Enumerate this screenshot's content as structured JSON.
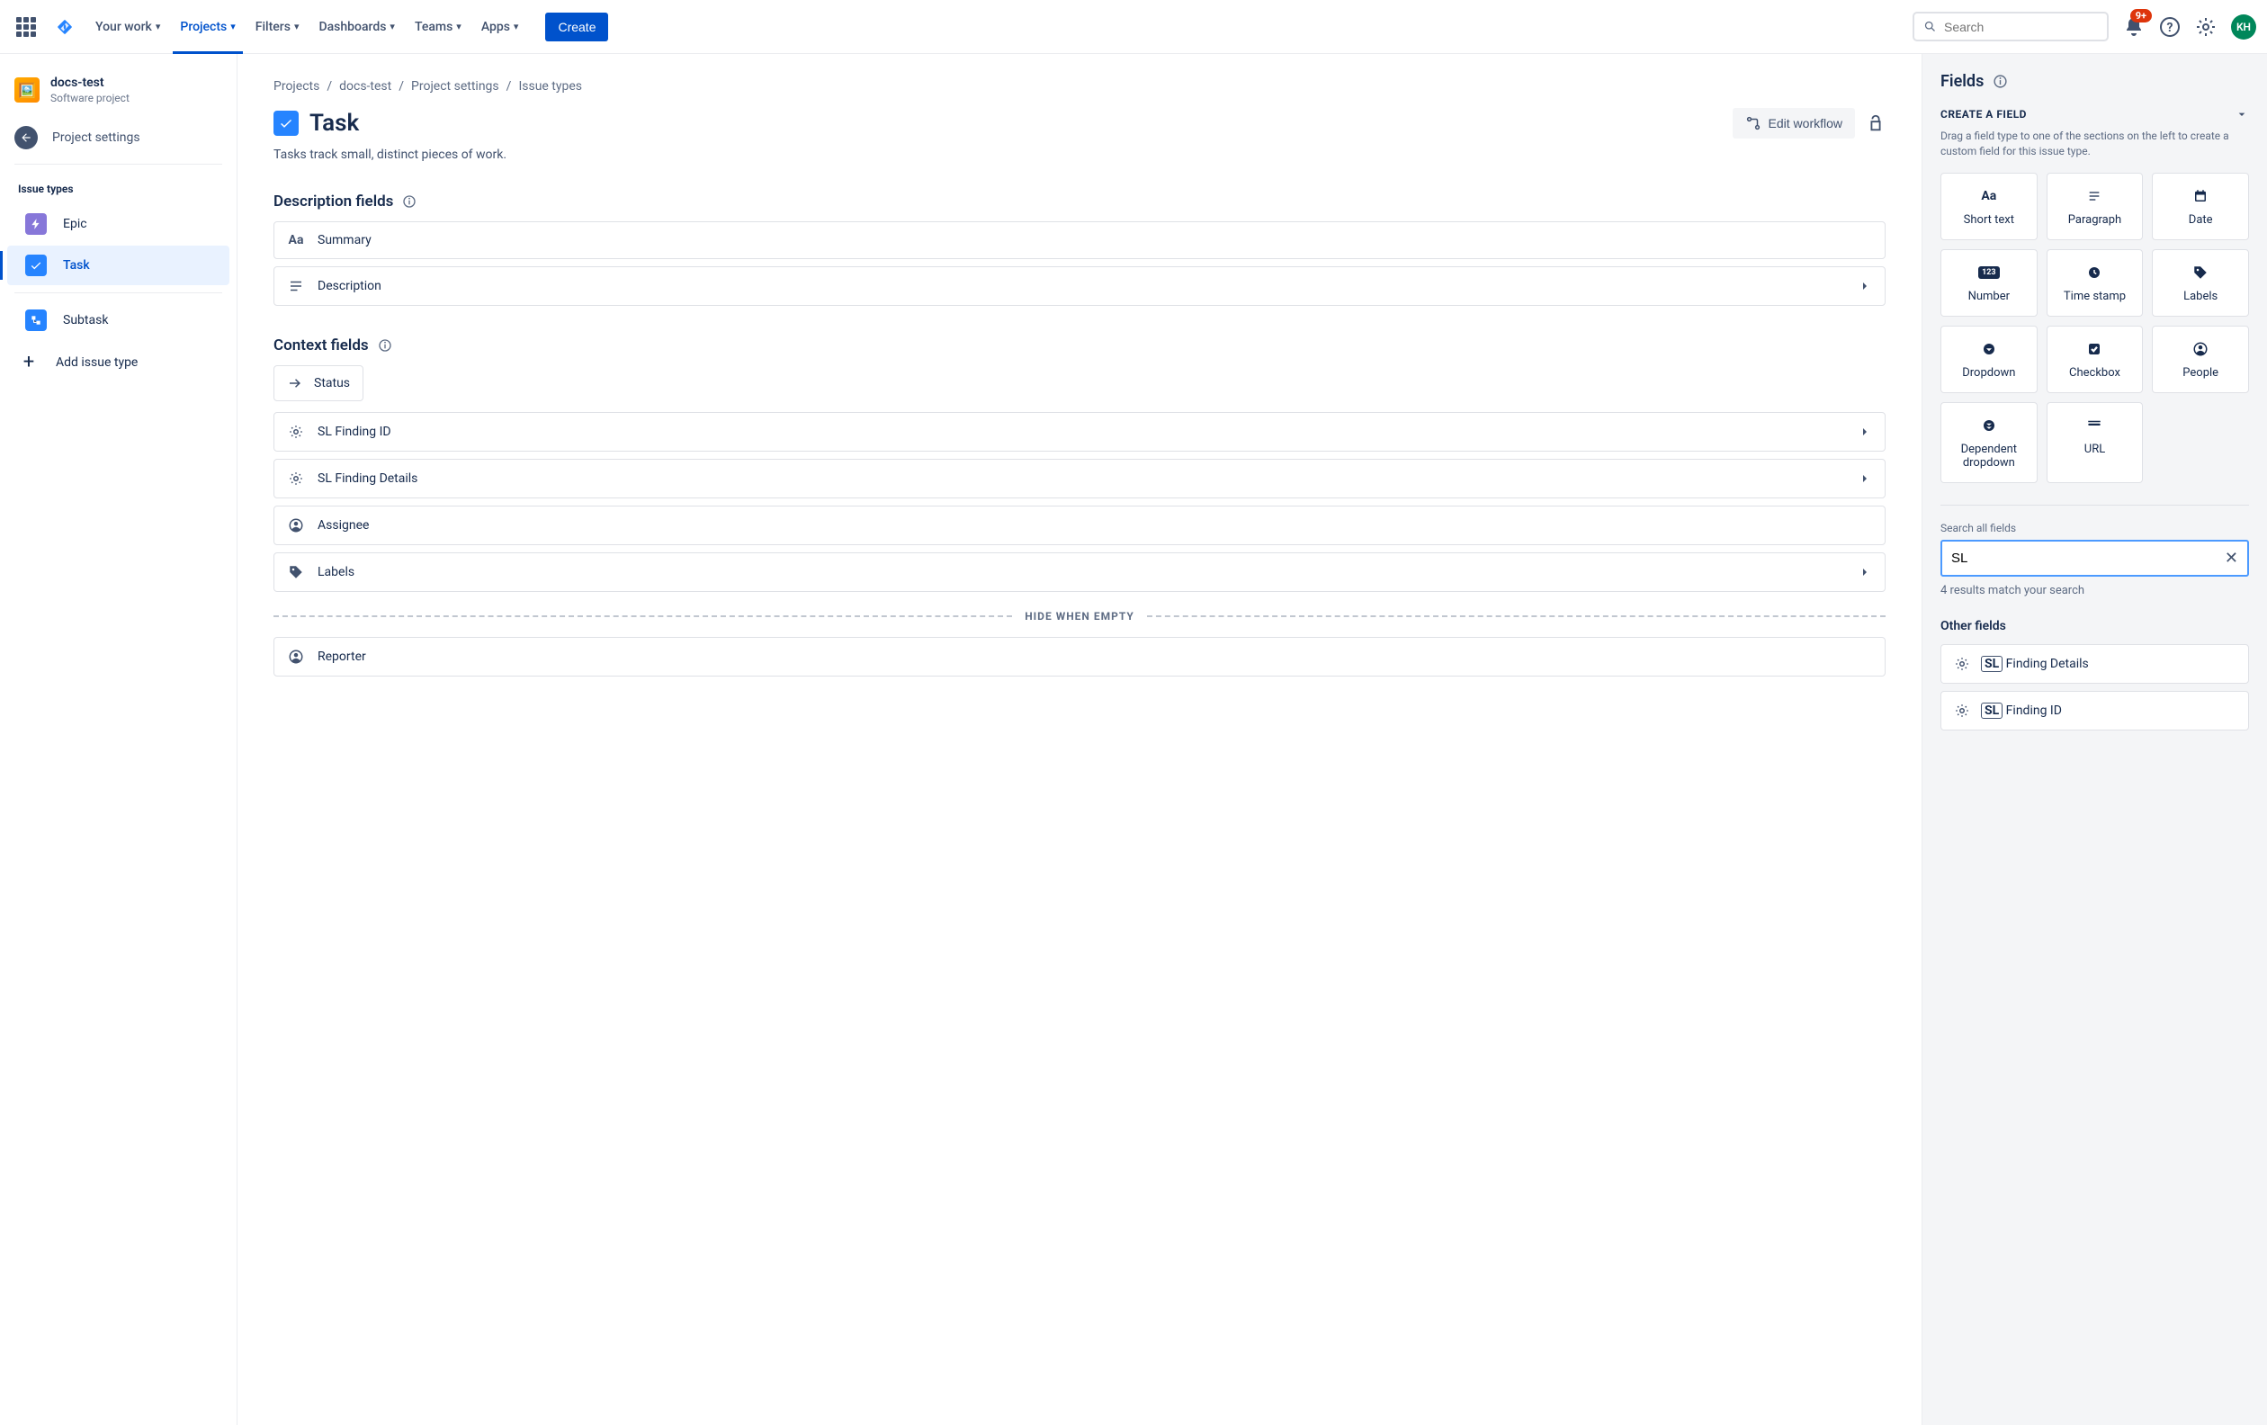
{
  "topnav": {
    "items": [
      {
        "label": "Your work"
      },
      {
        "label": "Projects",
        "active": true
      },
      {
        "label": "Filters"
      },
      {
        "label": "Dashboards"
      },
      {
        "label": "Teams"
      },
      {
        "label": "Apps"
      }
    ],
    "create_label": "Create",
    "search_placeholder": "Search",
    "notif_badge": "9+",
    "avatar_initials": "KH"
  },
  "sidebar": {
    "project_name": "docs-test",
    "project_type": "Software project",
    "back_label": "Project settings",
    "heading": "Issue types",
    "items": [
      {
        "label": "Epic",
        "chip": "epic"
      },
      {
        "label": "Task",
        "chip": "task",
        "selected": true
      },
      {
        "label": "Subtask",
        "chip": "subtask"
      }
    ],
    "add_label": "Add issue type"
  },
  "breadcrumb": [
    "Projects",
    "docs-test",
    "Project settings",
    "Issue types"
  ],
  "page": {
    "title": "Task",
    "description": "Tasks track small, distinct pieces of work.",
    "edit_workflow_label": "Edit workflow"
  },
  "description_fields": {
    "title": "Description fields",
    "items": [
      {
        "label": "Summary",
        "icon": "text"
      },
      {
        "label": "Description",
        "icon": "paragraph",
        "expandable": true
      }
    ]
  },
  "context_fields": {
    "title": "Context fields",
    "status_label": "Status",
    "items": [
      {
        "label": "SL Finding ID",
        "icon": "gear",
        "expandable": true
      },
      {
        "label": "SL Finding Details",
        "icon": "gear",
        "expandable": true
      },
      {
        "label": "Assignee",
        "icon": "person"
      },
      {
        "label": "Labels",
        "icon": "tag",
        "expandable": true
      }
    ],
    "divider_label": "HIDE WHEN EMPTY",
    "after": [
      {
        "label": "Reporter",
        "icon": "person"
      }
    ]
  },
  "right": {
    "title": "Fields",
    "create_heading": "CREATE A FIELD",
    "create_help": "Drag a field type to one of the sections on the left to create a custom field for this issue type.",
    "field_types": [
      {
        "label": "Short text",
        "icon": "Aa"
      },
      {
        "label": "Paragraph",
        "icon": "paragraph"
      },
      {
        "label": "Date",
        "icon": "calendar"
      },
      {
        "label": "Number",
        "icon": "123"
      },
      {
        "label": "Time stamp",
        "icon": "clock"
      },
      {
        "label": "Labels",
        "icon": "tag"
      },
      {
        "label": "Dropdown",
        "icon": "chevcircle"
      },
      {
        "label": "Checkbox",
        "icon": "check"
      },
      {
        "label": "People",
        "icon": "person"
      },
      {
        "label": "Dependent dropdown",
        "icon": "doublechev"
      },
      {
        "label": "URL",
        "icon": "link"
      }
    ],
    "search_label": "Search all fields",
    "search_value": "SL",
    "results_text": "4 results match your search",
    "other_title": "Other fields",
    "results": [
      {
        "prefix": "SL",
        "rest": " Finding Details"
      },
      {
        "prefix": "SL",
        "rest": " Finding ID"
      }
    ]
  }
}
